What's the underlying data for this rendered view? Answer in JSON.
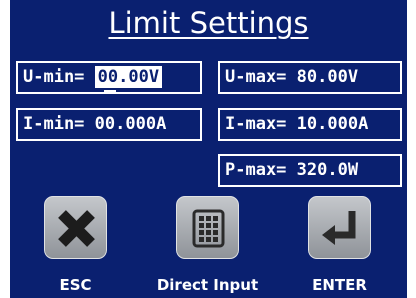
{
  "title": "Limit Settings",
  "fields": {
    "u_min": {
      "label": "U-min=",
      "value": "00.00V"
    },
    "u_max": {
      "label": "U-max=",
      "value": "80.00V"
    },
    "i_min": {
      "label": "I-min=",
      "value": "00.000A"
    },
    "i_max": {
      "label": "I-max=",
      "value": "10.000A"
    },
    "p_max": {
      "label": "P-max=",
      "value": "320.0W"
    }
  },
  "buttons": {
    "esc": {
      "label": "ESC",
      "icon": "close-icon"
    },
    "direct": {
      "label": "Direct Input",
      "icon": "keypad-icon"
    },
    "enter": {
      "label": "ENTER",
      "icon": "enter-icon"
    }
  },
  "colors": {
    "background": "#0a2070",
    "foreground": "#ffffff"
  }
}
